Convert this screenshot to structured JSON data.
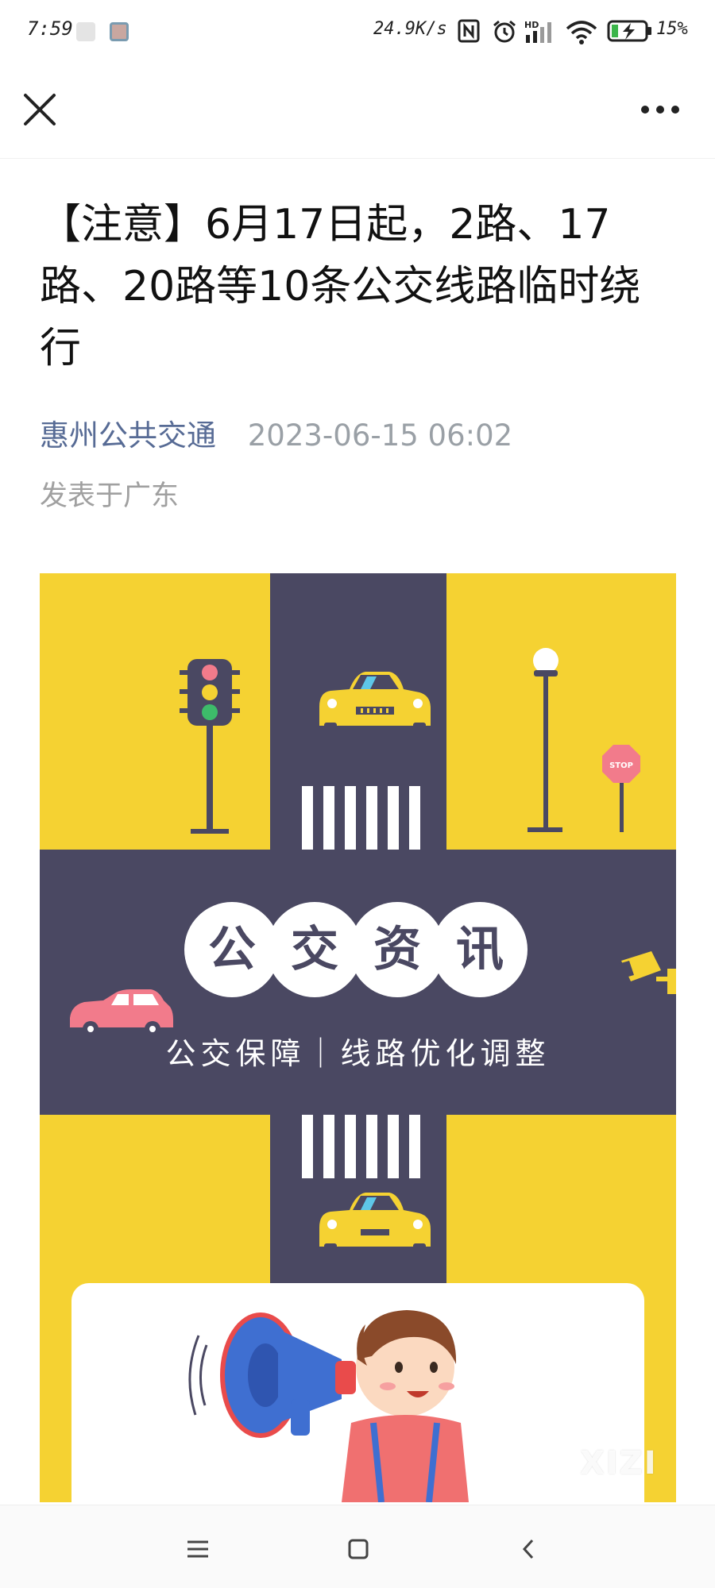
{
  "status_bar": {
    "time": "7:59",
    "network_speed": "24.9K/s",
    "battery": "15%",
    "icons": [
      "notification-app-icon",
      "notification-app-icon-2",
      "nfc-icon",
      "alarm-icon",
      "hd-signal-icon",
      "wifi-icon",
      "battery-charging-icon"
    ]
  },
  "nav": {
    "close_icon": "close-icon",
    "more_icon": "more-icon"
  },
  "article": {
    "title": "【注意】6月17日起，2路、17路、20路等10条公交线路临时绕行",
    "account": "惠州公共交通",
    "publish_time": "2023-06-15 06:02",
    "location": "发表于广东"
  },
  "poster": {
    "headline_chars": [
      "公",
      "交",
      "资",
      "讯"
    ],
    "subtitle": "公交保障｜线路优化调整",
    "stop_sign": "STOP",
    "watermark": "XIZI",
    "colors": {
      "yellow": "#f5d232",
      "road": "#4a4862",
      "white": "#ffffff"
    }
  },
  "system_nav": {
    "menu_icon": "menu-icon",
    "home_icon": "home-icon",
    "back_icon": "back-icon"
  }
}
